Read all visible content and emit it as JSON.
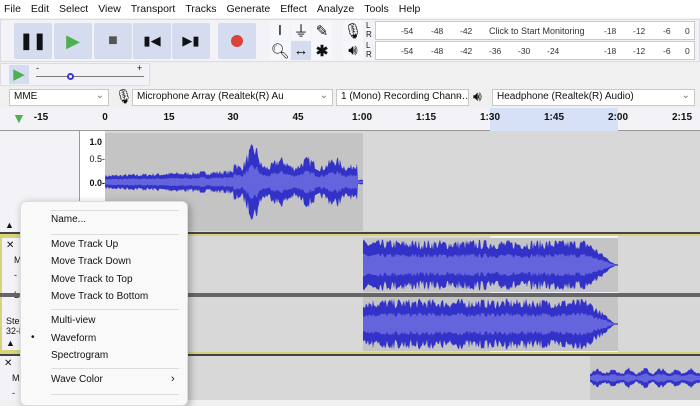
{
  "menu": [
    "File",
    "Edit",
    "Select",
    "View",
    "Transport",
    "Tracks",
    "Generate",
    "Effect",
    "Analyze",
    "Tools",
    "Help"
  ],
  "transport": {
    "pause": "pause-icon",
    "play": "play-icon",
    "stop": "stop-icon",
    "skip_start": "skip-start-icon",
    "skip_end": "skip-end-icon",
    "record": "record-icon",
    "play_color": "#4caf50",
    "record_color": "#d9433a"
  },
  "tools": [
    "selection-tool",
    "envelope-tool",
    "draw-tool",
    "zoom-tool",
    "time-shift-tool",
    "multi-tool"
  ],
  "meters": {
    "record_ticks": [
      "-54",
      "-48",
      "-42",
      "-18",
      "-12",
      "-6",
      "0"
    ],
    "record_label": "Click to Start Monitoring",
    "playback_ticks": [
      "-54",
      "-48",
      "-42",
      "-36",
      "-30",
      "-24",
      "-18",
      "-12",
      "-6",
      "0"
    ],
    "L": "L",
    "R": "R"
  },
  "speed": {
    "minus": "-",
    "plus": "+"
  },
  "devices": {
    "host": "MME",
    "mic": "Microphone Array (Realtek(R) Au",
    "channels": "1 (Mono) Recording Chann…",
    "output": "Headphone (Realtek(R) Audio)"
  },
  "ruler": [
    "-15",
    "0",
    "15",
    "30",
    "45",
    "1:00",
    "1:15",
    "1:30",
    "1:45",
    "2:00",
    "2:15"
  ],
  "track1": {
    "scale": [
      "1.0",
      "0.5-",
      "0.0-"
    ]
  },
  "track2": {
    "close": "✕",
    "mute": "M",
    "gain": "-",
    "pan": "L",
    "info1": "Stereo",
    "info2": "32-bit"
  },
  "track3": {
    "close": "✕",
    "mute": "M",
    "gain": "-"
  },
  "waveform_color": "#3232c8",
  "context_menu": {
    "name": "Name...",
    "up": "Move Track Up",
    "down": "Move Track Down",
    "top": "Move Track to Top",
    "bottom": "Move Track to Bottom",
    "multiview": "Multi-view",
    "waveform": "Waveform",
    "spectrogram": "Spectrogram",
    "wavecolor": "Wave Color",
    "bullet": "•",
    "arrow": "›"
  }
}
